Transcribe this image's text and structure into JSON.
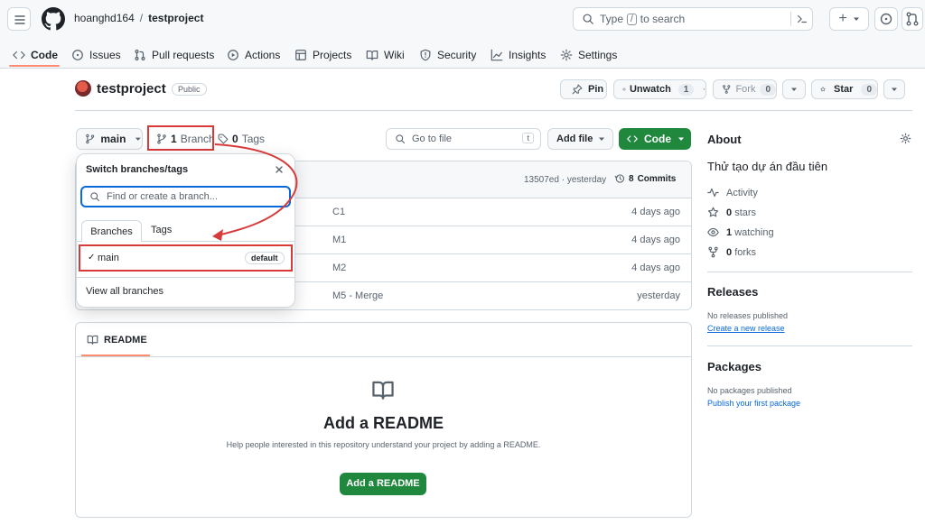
{
  "header": {
    "owner": "hoanghd164",
    "separator": "/",
    "repo": "testproject",
    "search_prefix": "Type",
    "search_key": "/",
    "search_suffix": "to search",
    "plus_label": "+"
  },
  "nav": {
    "tabs": [
      {
        "label": "Code",
        "icon": "code-icon"
      },
      {
        "label": "Issues",
        "icon": "issue-icon"
      },
      {
        "label": "Pull requests",
        "icon": "pull-request-icon"
      },
      {
        "label": "Actions",
        "icon": "play-icon"
      },
      {
        "label": "Projects",
        "icon": "table-icon"
      },
      {
        "label": "Wiki",
        "icon": "book-icon"
      },
      {
        "label": "Security",
        "icon": "shield-icon"
      },
      {
        "label": "Insights",
        "icon": "graph-icon"
      },
      {
        "label": "Settings",
        "icon": "gear-icon"
      }
    ]
  },
  "repo": {
    "name": "testproject",
    "visibility": "Public",
    "pin_label": "Pin",
    "unwatch_label": "Unwatch",
    "unwatch_count": "1",
    "fork_label": "Fork",
    "fork_count": "0",
    "star_label": "Star",
    "star_count": "0"
  },
  "toolbar": {
    "branch": "main",
    "branch_count": "1",
    "branch_word": "Branch",
    "tag_count": "0",
    "tag_word": "Tags",
    "goto_placeholder": "Go to file",
    "goto_key": "t",
    "add_file_label": "Add file",
    "code_label": "Code"
  },
  "commit_bar": {
    "hash": "13507ed · yesterday",
    "commits_count": "8",
    "commits_word": "Commits"
  },
  "files": [
    {
      "message": "C1",
      "time": "4 days ago"
    },
    {
      "message": "M1",
      "time": "4 days ago"
    },
    {
      "message": "M2",
      "time": "4 days ago"
    },
    {
      "message": "M5 - Merge",
      "time": "yesterday"
    }
  ],
  "dropdown": {
    "title": "Switch branches/tags",
    "filter_placeholder": "Find or create a branch...",
    "tabs": [
      "Branches",
      "Tags"
    ],
    "branch_name": "main",
    "branch_check": "✓",
    "default_badge": "default",
    "view_all": "View all branches"
  },
  "readme": {
    "tab_label": "README",
    "heading": "Add a README",
    "description": "Help people interested in this repository understand your project by adding a README.",
    "button": "Add a README"
  },
  "about": {
    "title": "About",
    "description": "Thử tạo dự án đầu tiên",
    "activity": "Activity",
    "stars_count": "0",
    "stars_word": "stars",
    "watching_count": "1",
    "watching_word": "watching",
    "forks_count": "0",
    "forks_word": "forks"
  },
  "releases": {
    "title": "Releases",
    "empty": "No releases published",
    "link": "Create a new release"
  },
  "packages": {
    "title": "Packages",
    "empty": "No packages published",
    "link": "Publish your first package"
  },
  "colors": {
    "accent_green": "#1f883d",
    "annotation_red": "#d83a3a",
    "link_blue": "#0969da",
    "tab_underline": "#fd8c73"
  }
}
